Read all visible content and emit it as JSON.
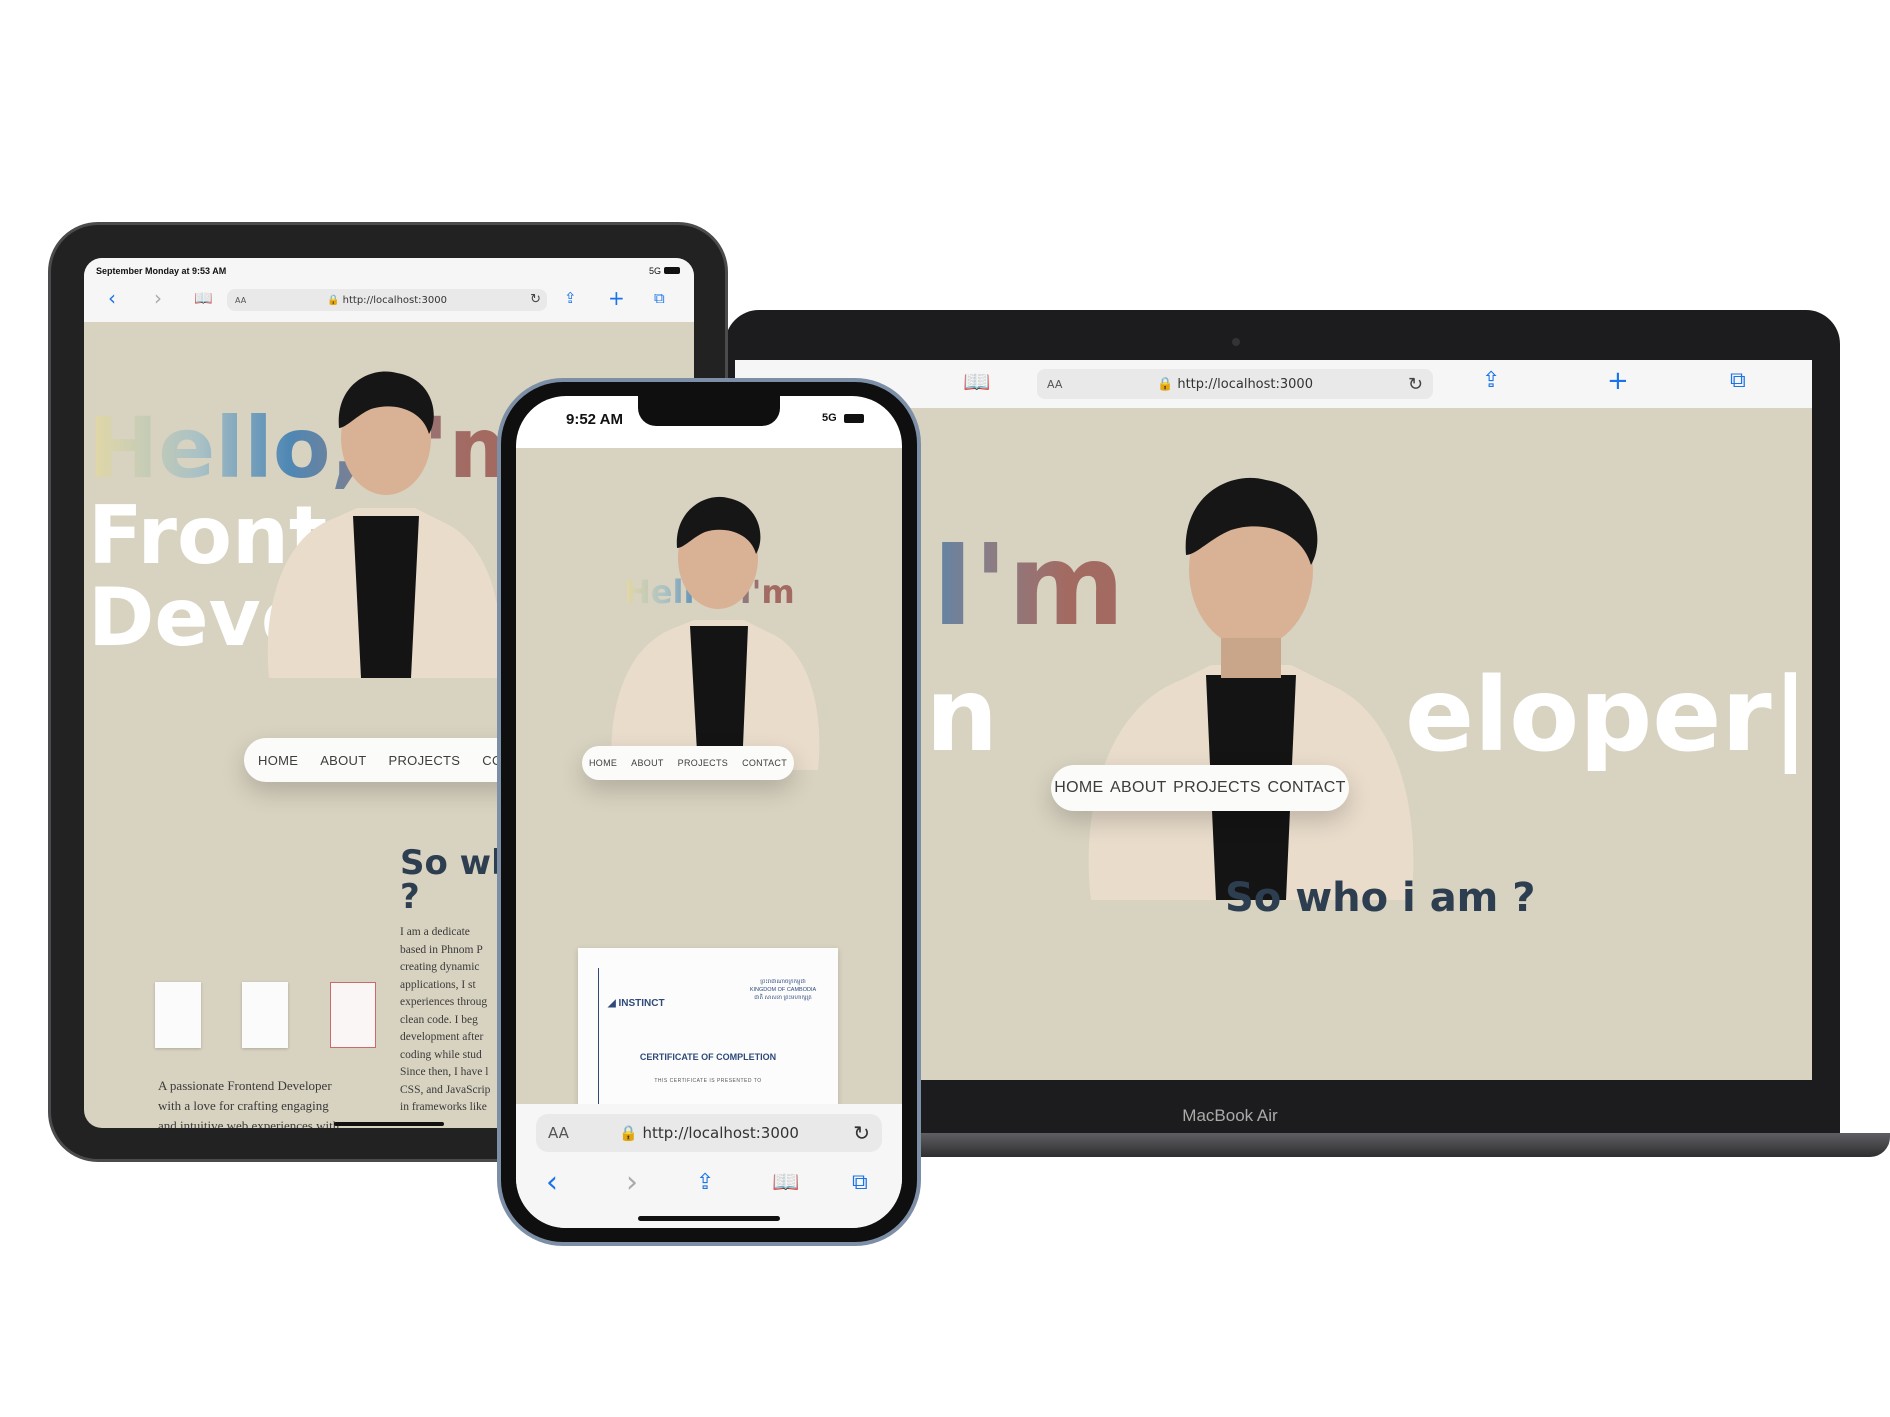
{
  "ipad": {
    "status_time": "September Monday at 9:53 AM",
    "status_signal": "5G",
    "url_aa": "AA",
    "url": "http://localhost:3000",
    "hero_line1": "Hello, I'm",
    "hero_line2": "Front",
    "hero_line3": "Deve",
    "nav": [
      "HOME",
      "ABOUT",
      "PROJECTS",
      "CONT"
    ],
    "about_title": "So wh",
    "about_title2": "?",
    "about_lines": [
      "I am a dedicate",
      "based in Phnom P",
      "creating dynamic",
      "applications, I st",
      "experiences throug",
      "clean code. I beg",
      "development after",
      "coding while stud",
      "Since then, I have l",
      "CSS, and JavaScrip",
      "in frameworks like"
    ],
    "tagline_lines": [
      "A passionate Frontend Developer",
      "with a love for crafting engaging",
      "and intuitive web experiences with"
    ]
  },
  "macbook": {
    "url_aa": "AA",
    "url": "http://localhost:3000",
    "hero_line1": "lo, I'm",
    "hero_line2a": "nten",
    "hero_line2b": "eloper|",
    "nav": [
      "HOME",
      "ABOUT",
      "PROJECTS",
      "CONTACT"
    ],
    "about_title": "So who i am ?",
    "label": "MacBook Air"
  },
  "iphone": {
    "status_time": "9:52 AM",
    "status_signal": "5G",
    "hero_line1": "Hello, I'm",
    "nav": [
      "HOME",
      "ABOUT",
      "PROJECTS",
      "CONTACT"
    ],
    "cert_org_line1": "INSTINCT",
    "cert_kh1": "ព្រះរាជាណាចក្រកម្ពុជា",
    "cert_kh2": "KINGDOM OF CAMBODIA",
    "cert_kh3": "ជាតិ សាសនា ព្រះមហាក្សត្រ",
    "cert_title": "CERTIFICATE OF COMPLETION",
    "cert_sub": "THIS CERTIFICATE IS PRESENTED TO",
    "url_aa": "AA",
    "url": "http://localhost:3000"
  },
  "colors": {
    "site_background": "#d8d2c0",
    "accent_blue": "#1a73e8",
    "device_frame": "#1b1b1b",
    "heading_dark": "#2d3e50"
  }
}
